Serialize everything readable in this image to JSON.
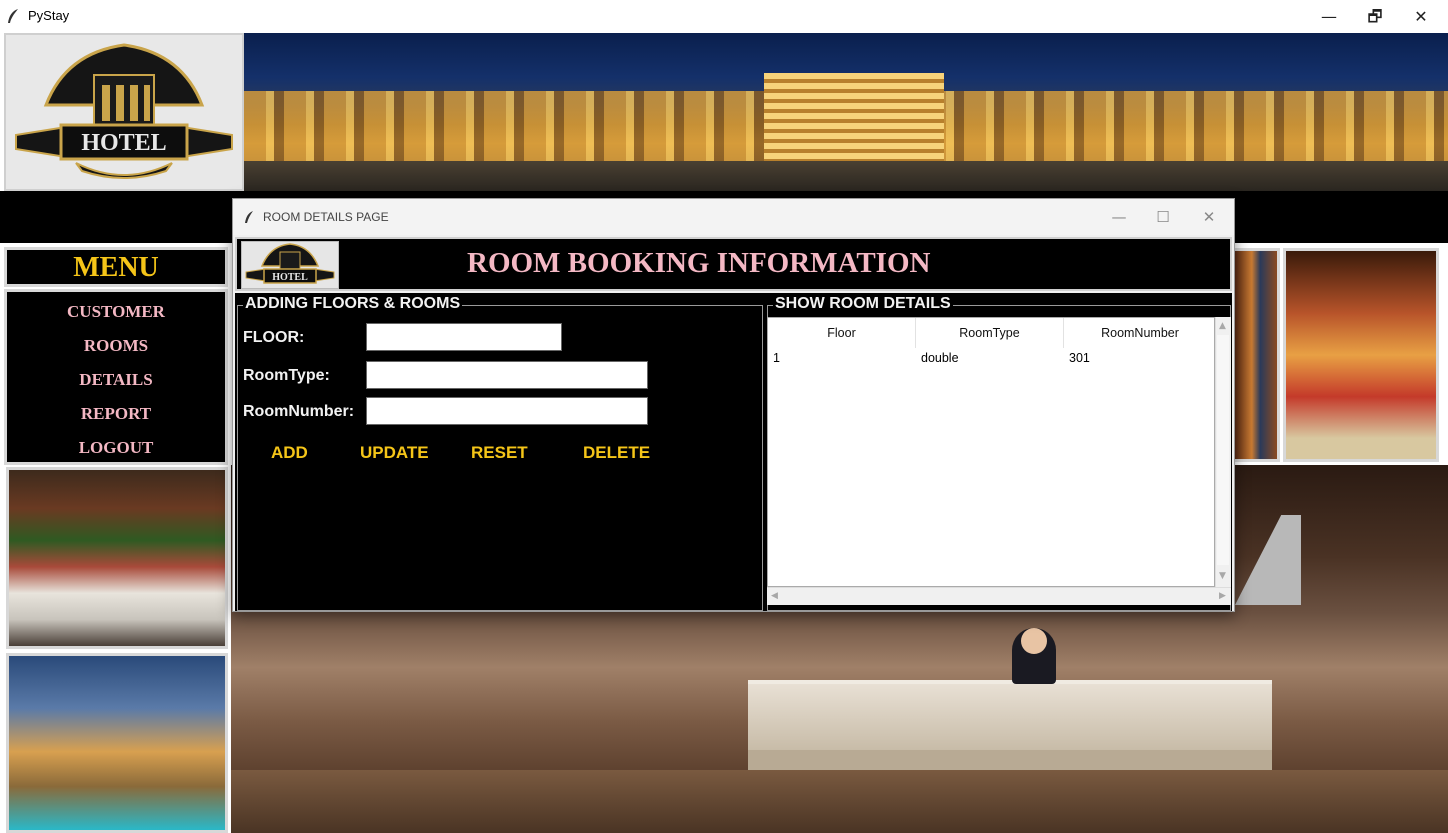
{
  "app": {
    "title": "PyStay",
    "window_controls": {
      "minimize": "—",
      "restore": "🗗",
      "close": "✕"
    }
  },
  "logo": {
    "text": "HOTEL"
  },
  "menu": {
    "heading": "MENU",
    "items": [
      "CUSTOMER",
      "ROOMS",
      "DETAILS",
      "REPORT",
      "LOGOUT"
    ]
  },
  "dialog": {
    "title": "ROOM DETAILS PAGE",
    "window_controls": {
      "minimize": "—",
      "maximize": "☐",
      "close": "✕"
    },
    "logo_text": "HOTEL",
    "heading": "ROOM BOOKING INFORMATION",
    "form": {
      "frame_title": "ADDING FLOORS & ROOMS",
      "floor_label": "FLOOR:",
      "floor_value": "",
      "roomtype_label": "RoomType:",
      "roomtype_value": "",
      "roomnumber_label": "RoomNumber:",
      "roomnumber_value": "",
      "buttons": {
        "add": "ADD",
        "update": "UPDATE",
        "reset": "RESET",
        "delete": "DELETE"
      }
    },
    "table": {
      "frame_title": "SHOW ROOM DETAILS",
      "columns": [
        "Floor",
        "RoomType",
        "RoomNumber"
      ],
      "rows": [
        [
          "1",
          "double",
          "301"
        ]
      ]
    }
  },
  "colors": {
    "menu_heading": "#f5c518",
    "menu_items": "#f4b8c4",
    "dialog_heading": "#f4b8c4",
    "action_buttons": "#f5c518",
    "panel_bg": "#000000"
  }
}
